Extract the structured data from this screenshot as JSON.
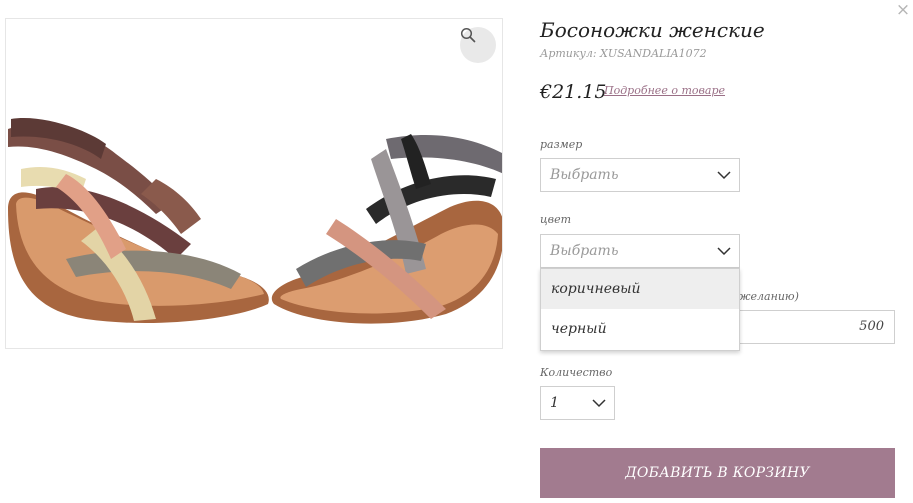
{
  "product": {
    "title": "Босоножки женские",
    "sku": "Артикул: XUSANDALIA1072",
    "price": "€21.15",
    "more_link": "Подробнее о товаре"
  },
  "size": {
    "label": "размер",
    "value": "Выбрать"
  },
  "color": {
    "label": "цвет",
    "value": "Выбрать",
    "options": [
      "коричневый",
      "черный"
    ],
    "highlighted": "коричневый"
  },
  "amount": {
    "label_partial": "желанию)",
    "value": "500"
  },
  "quantity": {
    "label": "Количество",
    "value": "1"
  },
  "add_to_cart": "ДОБАВИТЬ В КОРЗИНУ",
  "close_symbol": "×",
  "icons": {
    "close": "close-icon",
    "zoom": "magnifier-icon",
    "chevron": "chevron-down-icon"
  },
  "colors": {
    "accent": "#a27b8f",
    "link": "#9a6f86",
    "border": "#cfcfcf",
    "option_highlight": "#eeeeee"
  }
}
